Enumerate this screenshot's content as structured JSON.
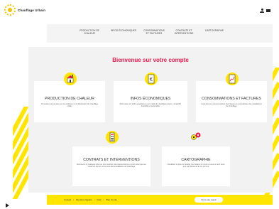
{
  "header": {
    "logo_text": "Chauffage Urbain",
    "user_icon": "user-icon",
    "mail_icon": "mail-icon"
  },
  "nav": {
    "items": [
      {
        "label": "PRODUCTION DE CHALEUR"
      },
      {
        "label": "INFOS ÉCONOMIQUES"
      },
      {
        "label": "CONSOMMATIONS ET FACTURES"
      },
      {
        "label": "CONTRATS ET INTERVENTIONS"
      },
      {
        "label": "CARTOGRAPHIE"
      }
    ]
  },
  "main": {
    "welcome": "Bienvenue sur votre compte",
    "cards": [
      {
        "title": "PRODUCTION DE CHALEUR",
        "desc": "Consulter les données sur la production et la distribution du chauffage urbain",
        "icon": "heat-production-icon"
      },
      {
        "title": "INFOS ÉCONOMIQUES",
        "desc": "Retrouvez vos tarifs actualisés ou un mode de chauffage propre, compétitif, équitable et accessible",
        "icon": "euro-icon"
      },
      {
        "title": "CONSOMMATIONS ET FACTURES",
        "desc": "Consulter les consommations thermiques ou consultéique des installations de chauffage",
        "icon": "invoice-icon"
      },
      {
        "title": "CONTRATS ET INTERVENTIONS",
        "desc": "Retrouvez ici quelques clés sur vos contrats, des interventions en cours ainsi que les mises en service ou le suivi des installations de chauffage",
        "icon": "contracts-icon"
      },
      {
        "title": "CARTOGRAPHIE",
        "desc": "Visualisez le plan du réseau, les travaux en cours et ceux à venir ainsi que les bâtiments à vos comme",
        "icon": "map-pin-icon"
      }
    ]
  },
  "footer": {
    "links": [
      "Contact",
      "Mentions légales",
      "FAQ",
      "Plan du site"
    ],
    "button": "Voir le site coquin",
    "accent": "#ffe500"
  },
  "colors": {
    "accent_yellow": "#ffe500",
    "welcome_red": "#e8204e",
    "band_gray": "#f2f2f2"
  }
}
